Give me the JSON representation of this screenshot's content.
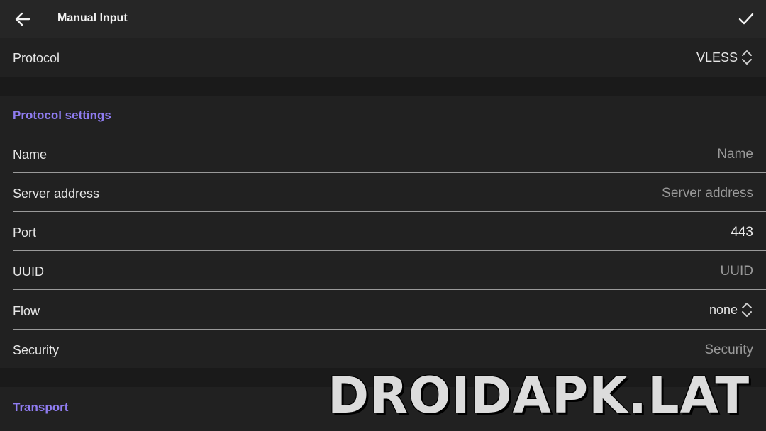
{
  "header": {
    "title": "Manual Input",
    "back_icon": "arrow-left-icon",
    "confirm_icon": "check-icon"
  },
  "protocol": {
    "label": "Protocol",
    "value": "VLESS"
  },
  "protocol_settings": {
    "heading": "Protocol settings",
    "fields": {
      "name": {
        "label": "Name",
        "placeholder": "Name",
        "value": ""
      },
      "server": {
        "label": "Server address",
        "placeholder": "Server address",
        "value": ""
      },
      "port": {
        "label": "Port",
        "value": "443"
      },
      "uuid": {
        "label": "UUID",
        "placeholder": "UUID",
        "value": ""
      },
      "flow": {
        "label": "Flow",
        "value": "none"
      },
      "security": {
        "label": "Security",
        "placeholder": "Security",
        "value": ""
      }
    }
  },
  "transport": {
    "heading": "Transport"
  },
  "watermark": "DROIDAPK.LAT",
  "colors": {
    "accent": "#8f7cf0",
    "background": "#1a1a1a",
    "surface": "#212121",
    "topbar": "#262626"
  }
}
